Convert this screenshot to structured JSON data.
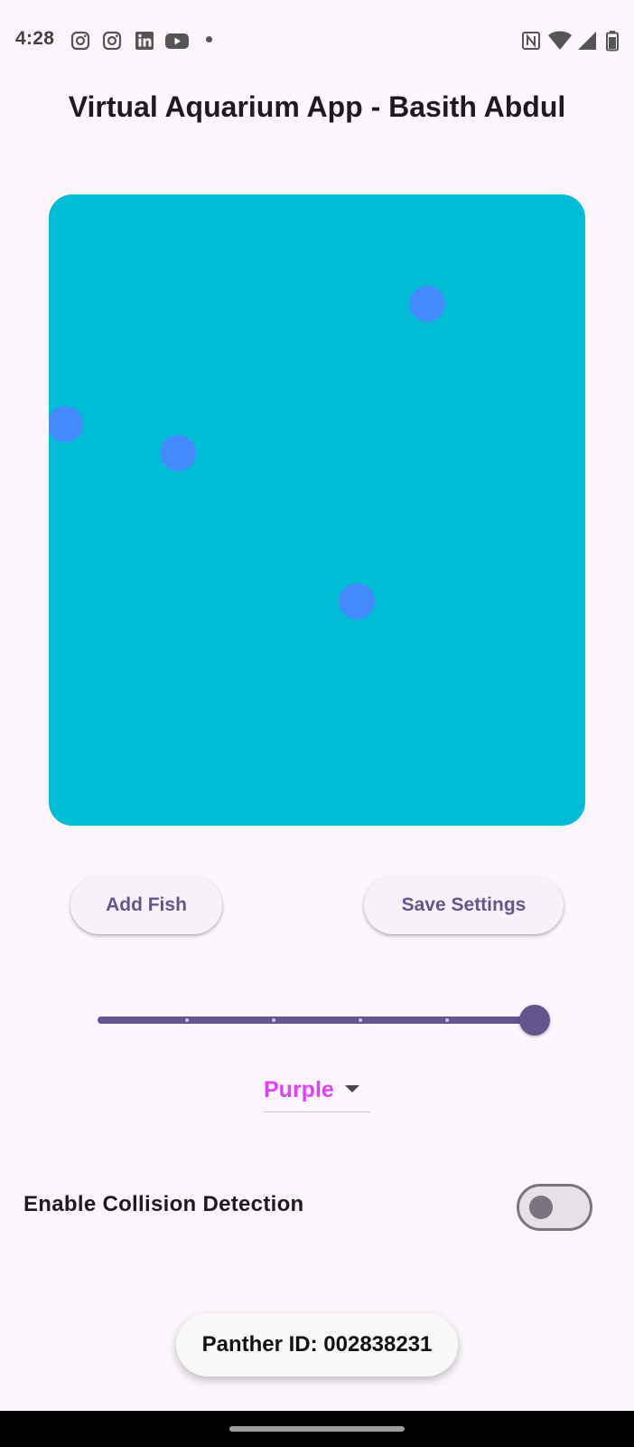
{
  "status_bar": {
    "time": "4:28",
    "left_icons": [
      "instagram-icon",
      "instagram-icon",
      "linkedin-icon",
      "youtube-icon",
      "notification-dot"
    ],
    "right_icons": [
      "nfc-icon",
      "wifi-icon",
      "cellular-signal-icon",
      "battery-icon"
    ]
  },
  "app": {
    "title": "Virtual Aquarium App - Basith Abdul"
  },
  "aquarium": {
    "background_color": "#00bcd4",
    "fish_color": "#448aff",
    "fish_count": 4
  },
  "buttons": {
    "add_fish": "Add Fish",
    "save_settings": "Save Settings"
  },
  "slider": {
    "value_fraction": 1.0,
    "divisions": 5,
    "active_color": "#65558f"
  },
  "color_dropdown": {
    "selected": "Purple",
    "selected_color": "#e040fb"
  },
  "collision": {
    "label": "Enable Collision Detection",
    "enabled": false
  },
  "panther": {
    "text": "Panther ID: 002838231"
  }
}
